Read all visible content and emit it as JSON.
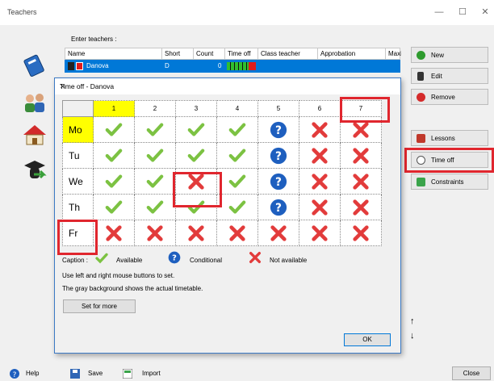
{
  "window": {
    "title": "Teachers"
  },
  "teachers": {
    "enter_label": "Enter teachers :",
    "columns": [
      "Name",
      "Short",
      "Count",
      "Time off",
      "Class teacher",
      "Approbation",
      "Maxi"
    ],
    "selected": {
      "name": "Danova",
      "short": "D",
      "count": "0"
    }
  },
  "sidebar_buttons": {
    "new": "New",
    "edit": "Edit",
    "remove": "Remove",
    "lessons": "Lessons",
    "timeoff": "Time off",
    "constraints": "Constraints"
  },
  "dialog": {
    "title": "Time off - Danova",
    "periods": [
      "1",
      "2",
      "3",
      "4",
      "5",
      "6",
      "7"
    ],
    "days": [
      "Mo",
      "Tu",
      "We",
      "Th",
      "Fr"
    ],
    "grid": [
      [
        "available",
        "available",
        "available",
        "available",
        "conditional",
        "not-available",
        "not-available"
      ],
      [
        "available",
        "available",
        "available",
        "available",
        "conditional",
        "not-available",
        "not-available"
      ],
      [
        "available",
        "available",
        "not-available",
        "available",
        "conditional",
        "not-available",
        "not-available"
      ],
      [
        "available",
        "available",
        "available",
        "available",
        "conditional",
        "not-available",
        "not-available"
      ],
      [
        "not-available",
        "not-available",
        "not-available",
        "not-available",
        "not-available",
        "not-available",
        "not-available"
      ]
    ],
    "caption_label": "Caption :",
    "legend_available": "Available",
    "legend_conditional": "Conditional",
    "legend_not_available": "Not available",
    "info_line1": "Use left and right mouse buttons to set.",
    "info_line2": "The gray background shows the actual timetable.",
    "set_for_more": "Set for more",
    "ok": "OK"
  },
  "bottom_bar": {
    "help": "Help",
    "save": "Save",
    "import": "Import",
    "close": "Close"
  },
  "colors": {
    "selection": "#0078d7",
    "highlight": "#ffff00",
    "annotation": "#e0262e",
    "check": "#7cc242",
    "cross": "#e23b3b",
    "question": "#1e5fbf"
  }
}
